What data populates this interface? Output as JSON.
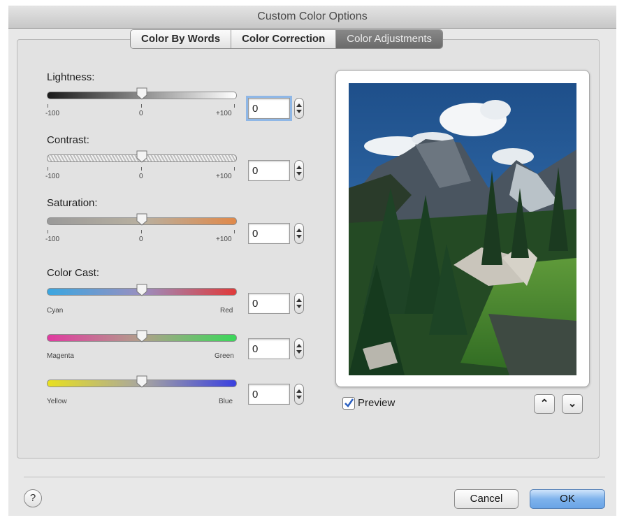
{
  "window": {
    "title": "Custom Color Options"
  },
  "tabs": [
    {
      "label": "Color By Words",
      "active": false
    },
    {
      "label": "Color Correction",
      "active": false
    },
    {
      "label": "Color Adjustments",
      "active": true
    }
  ],
  "sliders": {
    "lightness": {
      "label": "Lightness:",
      "min_label": "-100",
      "mid_label": "0",
      "max_label": "+100",
      "value": "0"
    },
    "contrast": {
      "label": "Contrast:",
      "min_label": "-100",
      "mid_label": "0",
      "max_label": "+100",
      "value": "0"
    },
    "saturation": {
      "label": "Saturation:",
      "min_label": "-100",
      "mid_label": "0",
      "max_label": "+100",
      "value": "0"
    }
  },
  "color_cast": {
    "label": "Color Cast:",
    "cyan_red": {
      "left_label": "Cyan",
      "right_label": "Red",
      "value": "0"
    },
    "magenta_green": {
      "left_label": "Magenta",
      "right_label": "Green",
      "value": "0"
    },
    "yellow_blue": {
      "left_label": "Yellow",
      "right_label": "Blue",
      "value": "0"
    }
  },
  "preview": {
    "label": "Preview",
    "checked": true,
    "up_icon": "chevron-up-icon",
    "down_icon": "chevron-down-icon"
  },
  "footer": {
    "help_label": "?",
    "cancel_label": "Cancel",
    "ok_label": "OK"
  },
  "colors": {
    "accent": "#6aa4e6",
    "active_tab": "#777777",
    "checkbox": "#3a6fc4"
  }
}
